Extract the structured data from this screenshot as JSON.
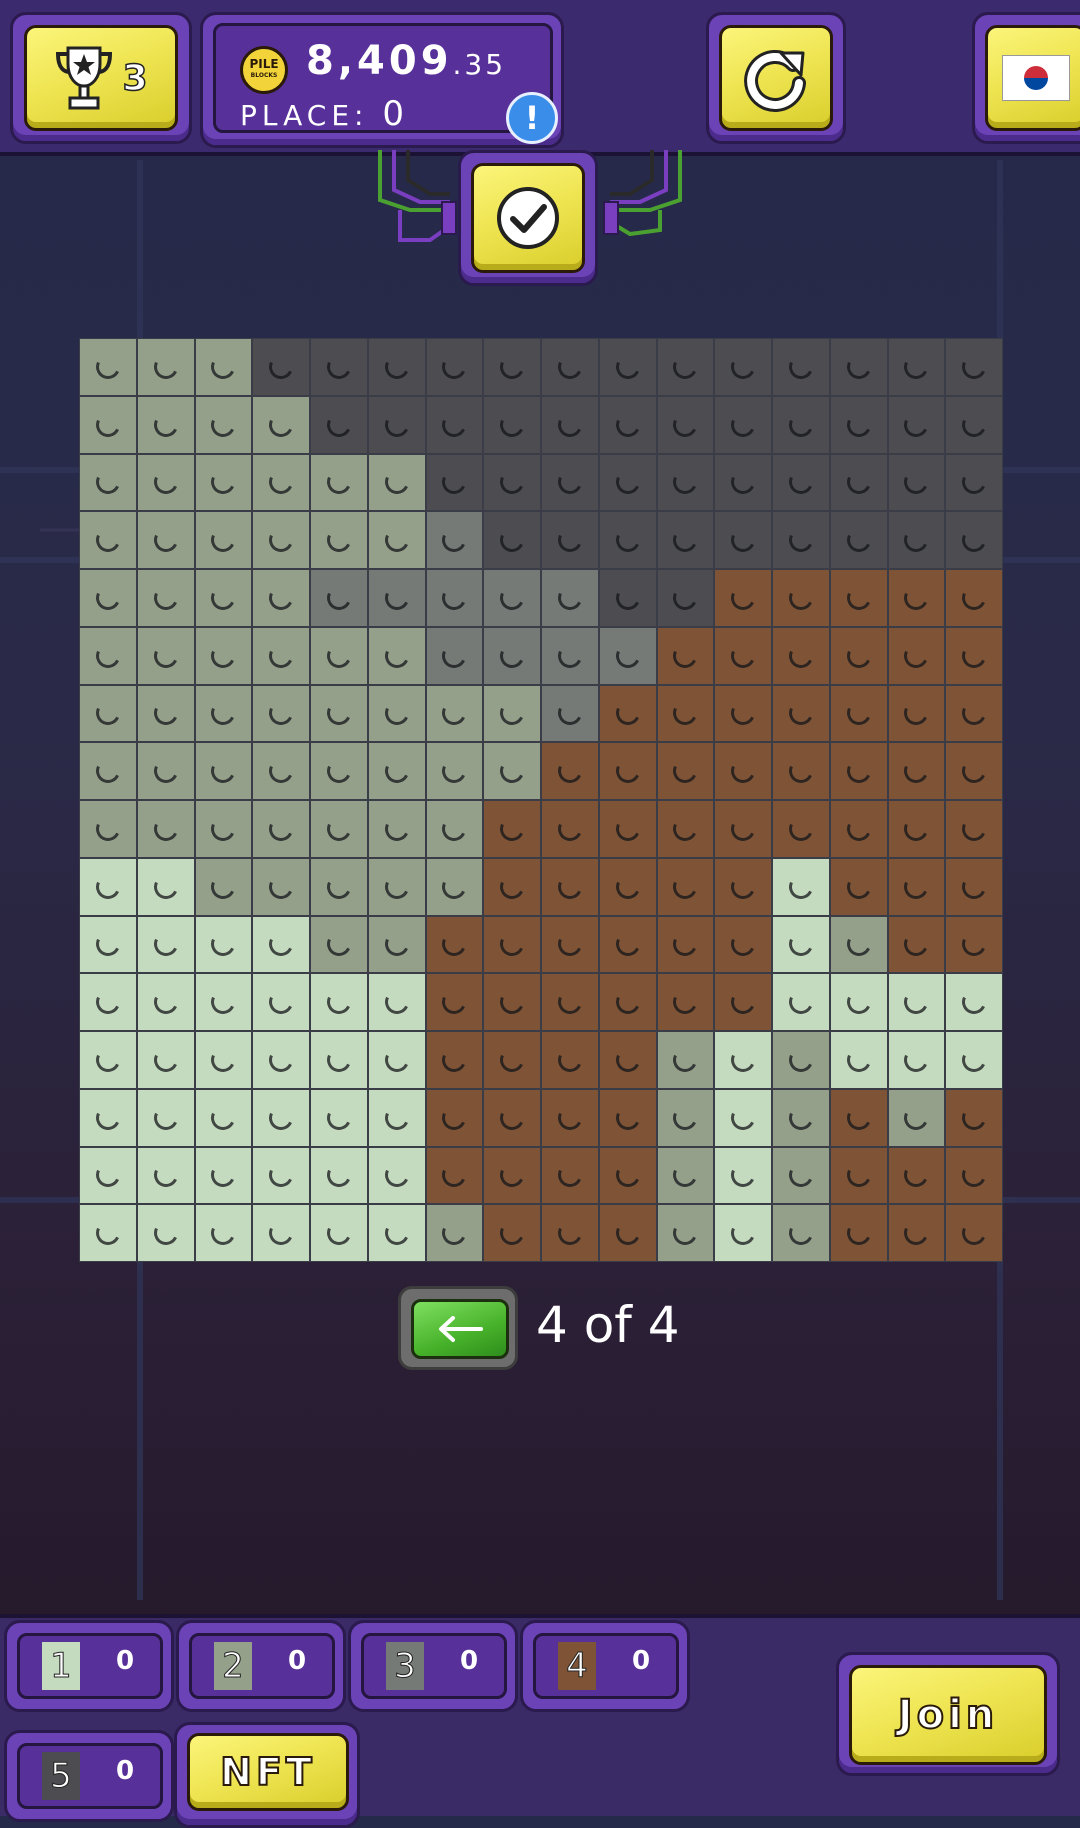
{
  "header": {
    "trophy_count": "3",
    "coin_text": "PILE",
    "coin_subtext": "BLOCKS",
    "balance_int": "8,409",
    "balance_dec": ".35",
    "place_label": "PLACE:",
    "place_value": "0",
    "info_symbol": "!"
  },
  "pager": {
    "text": "4 of 4"
  },
  "colors": {
    "1": "#c5dbbf",
    "2": "#94a08a",
    "3": "#757a76",
    "4": "#7f5436",
    "5": "#4d4d51"
  },
  "grid": [
    "2225555555555555",
    "2222555555555555",
    "2222225555555555",
    "2222223555555555",
    "2222333335544444",
    "2222223333444444",
    "2222222234444444",
    "2222222244444444",
    "2222222444444444",
    "1122222444441444",
    "1111224444441244",
    "1111114444441111",
    "1111114444212111",
    "1111114444212424",
    "1111114444212444",
    "1111112444212444"
  ],
  "palette": [
    {
      "number": "1",
      "count": "0",
      "color": "#c5dbbf"
    },
    {
      "number": "2",
      "count": "0",
      "color": "#94a08a"
    },
    {
      "number": "3",
      "count": "0",
      "color": "#757a76"
    },
    {
      "number": "4",
      "count": "0",
      "color": "#7f5436"
    },
    {
      "number": "5",
      "count": "0",
      "color": "#4d4d51"
    }
  ],
  "buttons": {
    "nft_label": "NFT",
    "join_label": "Join"
  }
}
